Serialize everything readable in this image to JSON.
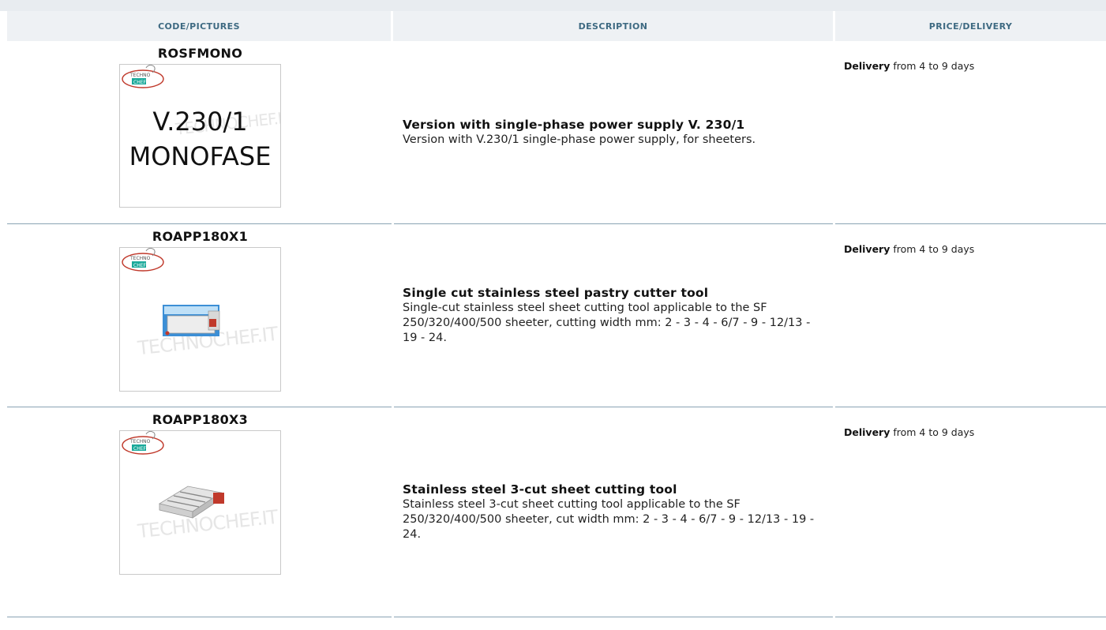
{
  "table": {
    "headers": {
      "code": "CODE/PICTURES",
      "description": "DESCRIPTION",
      "price": "PRICE/DELIVERY"
    },
    "rows": [
      {
        "code": "ROSFMONO",
        "image_text_1": "V.230/1",
        "image_text_2": "MONOFASE",
        "image": "voltage-label-image",
        "title": "Version with single-phase power supply V. 230/1",
        "text": "Version with V.230/1 single-phase power supply, for sheeters.",
        "delivery_label": "Delivery",
        "delivery_text": " from 4 to 9 days"
      },
      {
        "code": "ROAPP180X1",
        "image": "single-cut-tool-image",
        "title": "Single cut stainless steel pastry cutter tool",
        "text": "Single-cut stainless steel sheet cutting tool applicable to the SF 250/320/400/500 sheeter, cutting width mm: 2 - 3 - 4 - 6/7 - 9 - 12/13 - 19 - 24.",
        "delivery_label": "Delivery",
        "delivery_text": " from 4 to 9 days"
      },
      {
        "code": "ROAPP180X3",
        "image": "three-cut-tool-image",
        "title": "Stainless steel 3-cut sheet cutting tool",
        "text": "Stainless steel 3-cut sheet cutting tool applicable to the SF 250/320/400/500 sheeter, cut width mm: 2 - 3 - 4 - 6/7 - 9 - 12/13 - 19 - 24.",
        "delivery_label": "Delivery",
        "delivery_text": " from 4 to 9 days"
      }
    ]
  },
  "logo": {
    "line1": "TECHNO",
    "line2": "CHEF",
    "color": "#1aa99a",
    "ring_color": "#c0392b"
  },
  "watermark": "TECHNOCHEF.IT",
  "colors": {
    "header_text": "#3e6a82",
    "header_bg": "#eef1f4",
    "row_line": "#8aa4b4"
  }
}
